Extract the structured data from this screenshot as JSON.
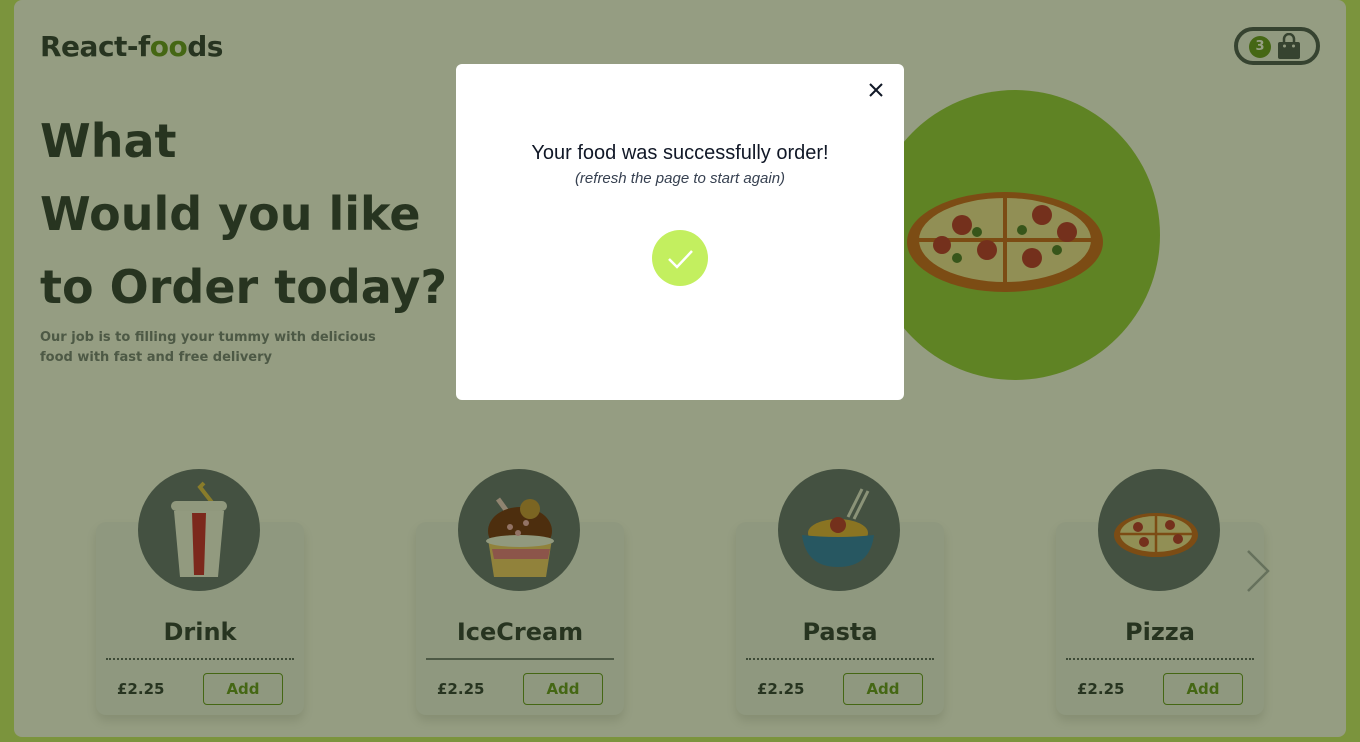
{
  "header": {
    "logo_prefix": "React-f",
    "logo_highlight": "oo",
    "logo_suffix": "ds",
    "cart_count": "3"
  },
  "hero": {
    "title_lines": [
      "What",
      "Would you like",
      "to Order today?"
    ],
    "subtitle": "Our job is to filling your tummy with delicious food with fast and free delivery"
  },
  "products": [
    {
      "name": "Drink",
      "price": "£2.25",
      "add_label": "Add"
    },
    {
      "name": "IceCream",
      "price": "£2.25",
      "add_label": "Add"
    },
    {
      "name": "Pasta",
      "price": "£2.25",
      "add_label": "Add"
    },
    {
      "name": "Pizza",
      "price": "£2.25",
      "add_label": "Add"
    }
  ],
  "modal": {
    "message": "Your food was successfully order!",
    "hint": "(refresh the page to start again)"
  },
  "colors": {
    "accent": "#5a8f1e",
    "hero_circle": "#8ec63f",
    "success": "#c3ef5f"
  }
}
